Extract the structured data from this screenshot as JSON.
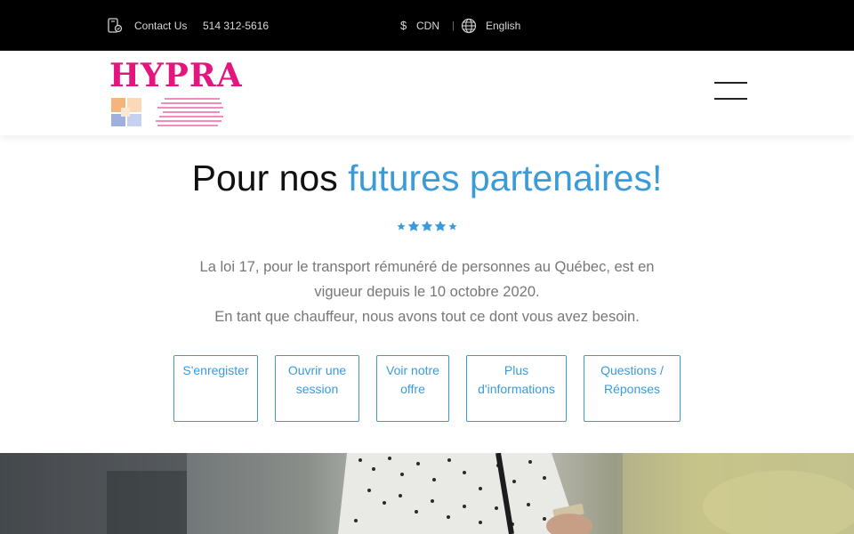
{
  "topbar": {
    "contact_label": "Contact Us",
    "phone": "514 312-5616",
    "currency_symbol": "$",
    "currency": "CDN",
    "separator": "|",
    "language": "English",
    "icons": [
      "contact-phone-icon",
      "dollar-icon",
      "globe-icon"
    ]
  },
  "header": {
    "logo_text": "HYPRA",
    "menu_icon": "hamburger-menu-icon",
    "colors": {
      "logo_pink": "#e3157f",
      "logo_orange": "#f5b47c",
      "logo_blue": "#9db0e0"
    }
  },
  "hero": {
    "title_plain": "Pour nos ",
    "title_accent": "futures partenaires!",
    "rating_icons": 5,
    "paragraph_line1": "La loi 17, pour le transport rémunéré de personnes au Québec, est en vigueur depuis le 10 octobre 2020.",
    "paragraph_line2": "En tant que chauffeur, nous avons tout ce dont vous avez besoin.",
    "accent_color": "#3b9bd9"
  },
  "buttons": [
    {
      "label": "S'enregister"
    },
    {
      "label": "Ouvrir une session"
    },
    {
      "label": "Voir notre offre"
    },
    {
      "label": "Plus d'informations"
    },
    {
      "label": "Questions / Réponses"
    }
  ]
}
